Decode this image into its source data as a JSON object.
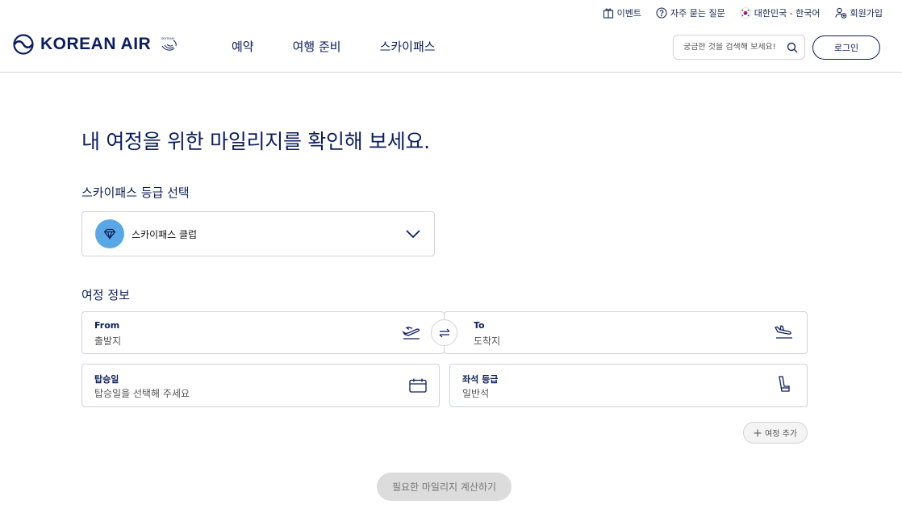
{
  "utility": {
    "event": "이벤트",
    "faq": "자주 묻는 질문",
    "locale": "대한민국 - 한국어",
    "signup": "회원가입"
  },
  "brand": {
    "name": "KOREAN AIR",
    "alliance": "SKYTEAM",
    "color": "#0c1e5a"
  },
  "nav": {
    "items": [
      "예약",
      "여행 준비",
      "스카이패스"
    ]
  },
  "search": {
    "placeholder": "궁금한 것을 검색해 보세요!"
  },
  "login": {
    "label": "로그인"
  },
  "page": {
    "title": "내 여정을 위한 마일리지를 확인해 보세요."
  },
  "grade": {
    "section_label": "스카이패스 등급 선택",
    "selected": "스카이패스 클럽",
    "badge_color": "#5aa7e6"
  },
  "itinerary": {
    "section_label": "여정 정보",
    "from": {
      "label": "From",
      "placeholder": "출발지"
    },
    "to": {
      "label": "To",
      "placeholder": "도착지"
    },
    "date": {
      "label": "탑승일",
      "placeholder": "탑승일을 선택해 주세요"
    },
    "cabin": {
      "label": "좌석 등급",
      "value": "일반석"
    },
    "add_trip": "여정 추가"
  },
  "calculate": {
    "label": "필요한 마일리지 계산하기"
  },
  "icons": {
    "event": "gift-icon",
    "faq": "question-circle-icon",
    "locale": "korea-flag-icon",
    "signup": "user-add-icon",
    "search": "search-icon",
    "grade_badge": "diamond-icon",
    "grade_toggle": "chevron-down-icon",
    "departure": "takeoff-icon",
    "arrival": "landing-icon",
    "swap": "swap-icon",
    "date": "calendar-icon",
    "cabin": "seat-icon",
    "add": "plus-icon"
  }
}
